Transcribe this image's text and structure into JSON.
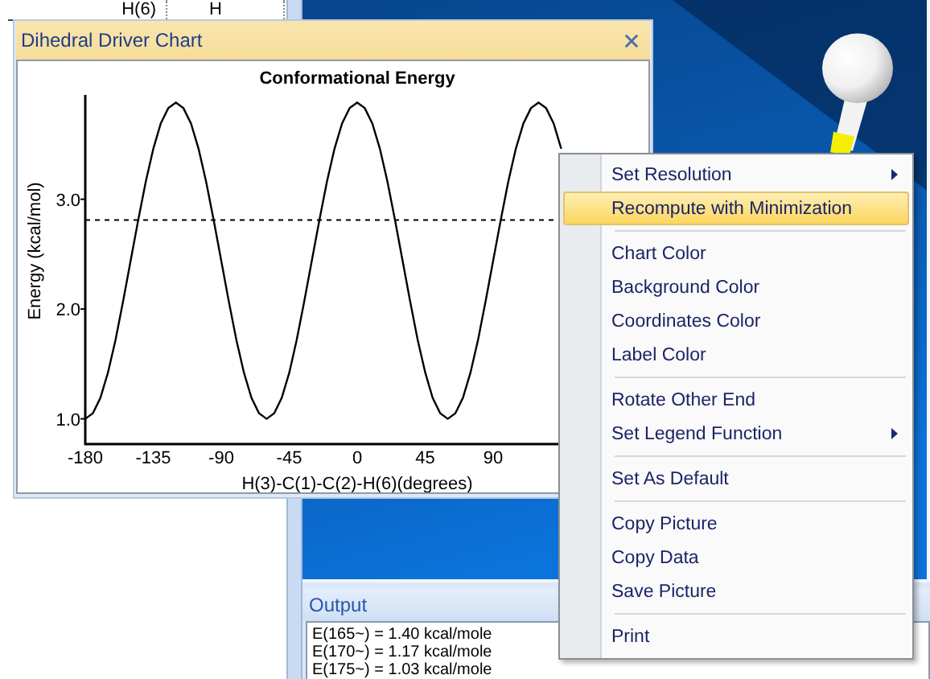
{
  "table": {
    "cells": [
      "H(6)",
      "H"
    ]
  },
  "chart_window": {
    "title": "Dihedral Driver Chart",
    "chart_data": {
      "type": "line",
      "title": "Conformational Energy",
      "xlabel": "H(3)-C(1)-C(2)-H(6)(degrees)",
      "ylabel": "Energy (kcal/mol)",
      "xlim": [
        -180,
        180
      ],
      "ylim": [
        0.77,
        3.95
      ],
      "xticks": [
        {
          "value": -180,
          "label": "-180"
        },
        {
          "value": -135,
          "label": "-135"
        },
        {
          "value": -90,
          "label": "-90"
        },
        {
          "value": -45,
          "label": "-45"
        },
        {
          "value": 0,
          "label": "0"
        },
        {
          "value": 45,
          "label": "45"
        },
        {
          "value": 90,
          "label": "90"
        }
      ],
      "yticks": [
        {
          "value": 1,
          "label": "1.0"
        },
        {
          "value": 2,
          "label": "2.0"
        },
        {
          "value": 3,
          "label": "3.0"
        }
      ],
      "x": [
        -180,
        -175,
        -170,
        -165,
        -160,
        -155,
        -150,
        -145,
        -140,
        -135,
        -130,
        -125,
        -120,
        -115,
        -110,
        -105,
        -100,
        -95,
        -90,
        -85,
        -80,
        -75,
        -70,
        -65,
        -60,
        -55,
        -50,
        -45,
        -40,
        -35,
        -30,
        -25,
        -20,
        -15,
        -10,
        -5,
        0,
        5,
        10,
        15,
        20,
        25,
        30,
        35,
        40,
        45,
        50,
        55,
        60,
        65,
        70,
        75,
        80,
        85,
        90,
        95,
        100,
        105,
        110,
        115,
        120,
        125,
        130,
        135
      ],
      "series": [
        {
          "color": "#000000",
          "line_style": "solid",
          "values": [
            1.0,
            1.05,
            1.19,
            1.42,
            1.72,
            2.07,
            2.44,
            2.81,
            3.16,
            3.46,
            3.69,
            3.83,
            3.88,
            3.83,
            3.69,
            3.46,
            3.16,
            2.81,
            2.44,
            2.07,
            1.72,
            1.42,
            1.19,
            1.05,
            1.0,
            1.05,
            1.19,
            1.42,
            1.72,
            2.07,
            2.44,
            2.81,
            3.16,
            3.46,
            3.69,
            3.83,
            3.88,
            3.83,
            3.69,
            3.46,
            3.16,
            2.81,
            2.44,
            2.07,
            1.72,
            1.42,
            1.19,
            1.05,
            1.0,
            1.05,
            1.19,
            1.42,
            1.72,
            2.07,
            2.44,
            2.81,
            3.16,
            3.46,
            3.69,
            3.83,
            3.88,
            3.83,
            3.69,
            3.46
          ]
        },
        {
          "color": "#000000",
          "line_style": "dashed",
          "values": [
            2.81,
            2.81,
            2.81,
            2.81,
            2.81,
            2.81,
            2.81,
            2.81,
            2.81,
            2.81,
            2.81,
            2.81,
            2.81,
            2.81,
            2.81,
            2.81,
            2.81,
            2.81,
            2.81,
            2.81,
            2.81,
            2.81,
            2.81,
            2.81,
            2.81,
            2.81,
            2.81,
            2.81,
            2.81,
            2.81,
            2.81,
            2.81,
            2.81,
            2.81,
            2.81,
            2.81,
            2.81,
            2.81,
            2.81,
            2.81,
            2.81,
            2.81,
            2.81,
            2.81,
            2.81,
            2.81,
            2.81,
            2.81,
            2.81,
            2.81,
            2.81,
            2.81,
            2.81,
            2.81,
            2.81,
            2.81,
            2.81,
            2.81,
            2.81,
            2.81,
            2.81,
            2.81,
            2.81,
            null
          ]
        }
      ]
    }
  },
  "context_menu": {
    "items": [
      {
        "kind": "item",
        "label": "Set Resolution",
        "selected": false,
        "submenu": true
      },
      {
        "kind": "item",
        "label": "Recompute with Minimization",
        "selected": true,
        "submenu": false
      },
      {
        "kind": "separator"
      },
      {
        "kind": "item",
        "label": "Chart Color",
        "selected": false,
        "submenu": false
      },
      {
        "kind": "item",
        "label": "Background Color",
        "selected": false,
        "submenu": false
      },
      {
        "kind": "item",
        "label": "Coordinates Color",
        "selected": false,
        "submenu": false
      },
      {
        "kind": "item",
        "label": "Label Color",
        "selected": false,
        "submenu": false
      },
      {
        "kind": "separator"
      },
      {
        "kind": "item",
        "label": "Rotate Other End",
        "selected": false,
        "submenu": false
      },
      {
        "kind": "item",
        "label": "Set Legend Function",
        "selected": false,
        "submenu": true
      },
      {
        "kind": "separator"
      },
      {
        "kind": "item",
        "label": "Set As Default",
        "selected": false,
        "submenu": false
      },
      {
        "kind": "separator"
      },
      {
        "kind": "item",
        "label": "Copy Picture",
        "selected": false,
        "submenu": false
      },
      {
        "kind": "item",
        "label": "Copy Data",
        "selected": false,
        "submenu": false
      },
      {
        "kind": "item",
        "label": "Save Picture",
        "selected": false,
        "submenu": false
      },
      {
        "kind": "separator"
      },
      {
        "kind": "item",
        "label": "Print",
        "selected": false,
        "submenu": false
      }
    ]
  },
  "output": {
    "title": "Output",
    "lines": [
      "E(165~) = 1.40 kcal/mole",
      "E(170~) = 1.17 kcal/mole",
      "E(175~) = 1.03 kcal/mole"
    ]
  }
}
